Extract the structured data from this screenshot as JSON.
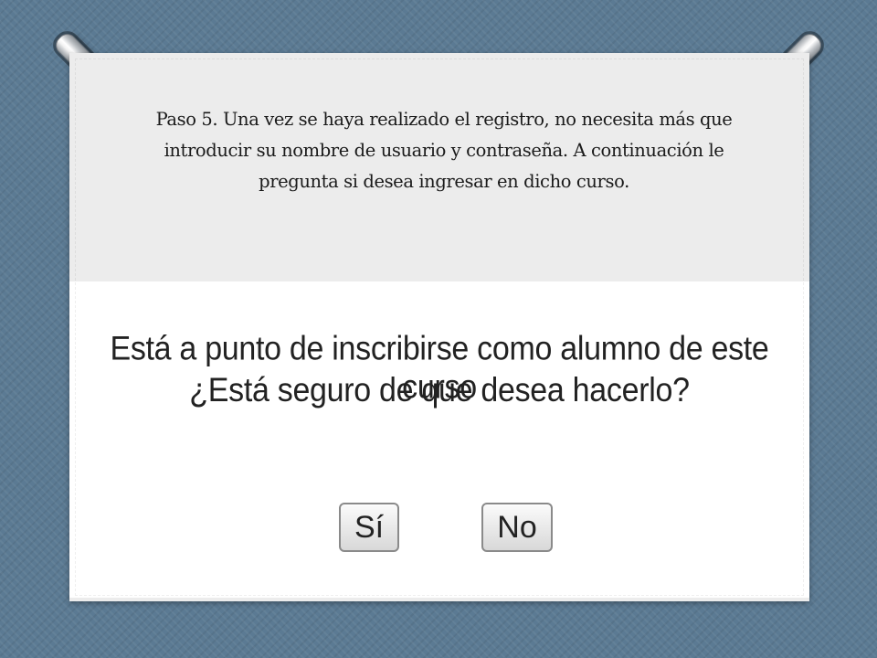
{
  "slide": {
    "instruction_text": "Paso 5. Una vez se haya realizado el registro, no necesita más que\nintroducir su nombre de usuario y contraseña. A continuación le\npregunta si desea ingresar en dicho curso."
  },
  "dialog": {
    "line1": "Está a punto de inscribirse como alumno de este curso",
    "line2": "¿Está seguro de que desea hacerlo?",
    "yes_label": "Sí",
    "no_label": "No"
  },
  "colors": {
    "background": "#5b7a93",
    "card": "#ececec",
    "dialog_background": "#ffffff"
  }
}
